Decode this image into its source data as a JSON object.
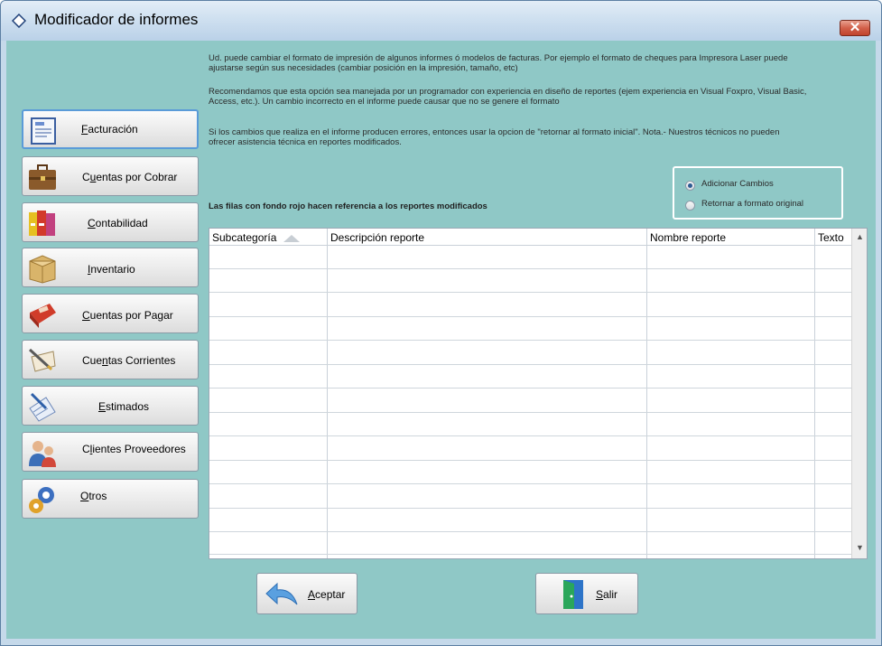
{
  "window": {
    "title": "Modificador de informes",
    "close_label": "✕"
  },
  "info": {
    "p1_l1": "Ud. puede cambiar el formato de impresión de algunos informes ó modelos de facturas. Por ejemplo el formato de cheques para Impresora Laser puede",
    "p1_l2": "ajustarse según sus necesidades (cambiar posición en la impresión, tamaño, etc)",
    "p2_l1": "Recomendamos que esta opción sea manejada por un programador con experiencia en diseño de reportes (ejem experiencia en Visual Foxpro, Visual Basic,",
    "p2_l2": "Access, etc.). Un cambio incorrecto en el informe puede causar que no se genere el formato",
    "p3_l1": "Si los cambios que realiza en el informe producen errores, entonces usar la opcion de \"retornar al formato inicial\". Nota.- Nuestros técnicos no pueden",
    "p3_l2": "ofrecer asistencia técnica en reportes modificados."
  },
  "sidebar": [
    {
      "pre": "",
      "mn": "F",
      "post": "acturación",
      "icon": "invoice-icon"
    },
    {
      "pre": "C",
      "mn": "u",
      "post": "entas por Cobrar",
      "icon": "briefcase-icon"
    },
    {
      "pre": "",
      "mn": "C",
      "post": "ontabilidad",
      "icon": "binders-icon"
    },
    {
      "pre": "",
      "mn": "I",
      "post": "nventario",
      "icon": "box-icon"
    },
    {
      "pre": "",
      "mn": "C",
      "post": "uentas por Pagar",
      "icon": "cash-register-icon"
    },
    {
      "pre": "Cue",
      "mn": "n",
      "post": "tas Corrientes",
      "icon": "pen-paper-icon"
    },
    {
      "pre": "",
      "mn": "E",
      "post": "stimados",
      "icon": "edit-document-icon"
    },
    {
      "pre": "C",
      "mn": "l",
      "post": "ientes Proveedores",
      "icon": "people-icon"
    },
    {
      "pre": "",
      "mn": "O",
      "post": "tros",
      "icon": "gears-icon"
    }
  ],
  "options": {
    "add_changes": "Adicionar Cambios",
    "revert": "Retornar a formato original",
    "selected": "add_changes"
  },
  "note": "Las filas con fondo rojo hacen referencia  a los reportes modificados",
  "table": {
    "headers": {
      "subcategory": "Subcategoría",
      "description": "Descripción  reporte",
      "report_name": "Nombre reporte",
      "text": "Texto"
    },
    "rows": []
  },
  "buttons": {
    "accept": {
      "pre": "",
      "mn": "A",
      "post": "ceptar"
    },
    "exit": {
      "pre": "",
      "mn": "S",
      "post": "alir"
    }
  },
  "colors": {
    "client_bg": "#8fc8c6",
    "accent": "#5a9bd8"
  }
}
